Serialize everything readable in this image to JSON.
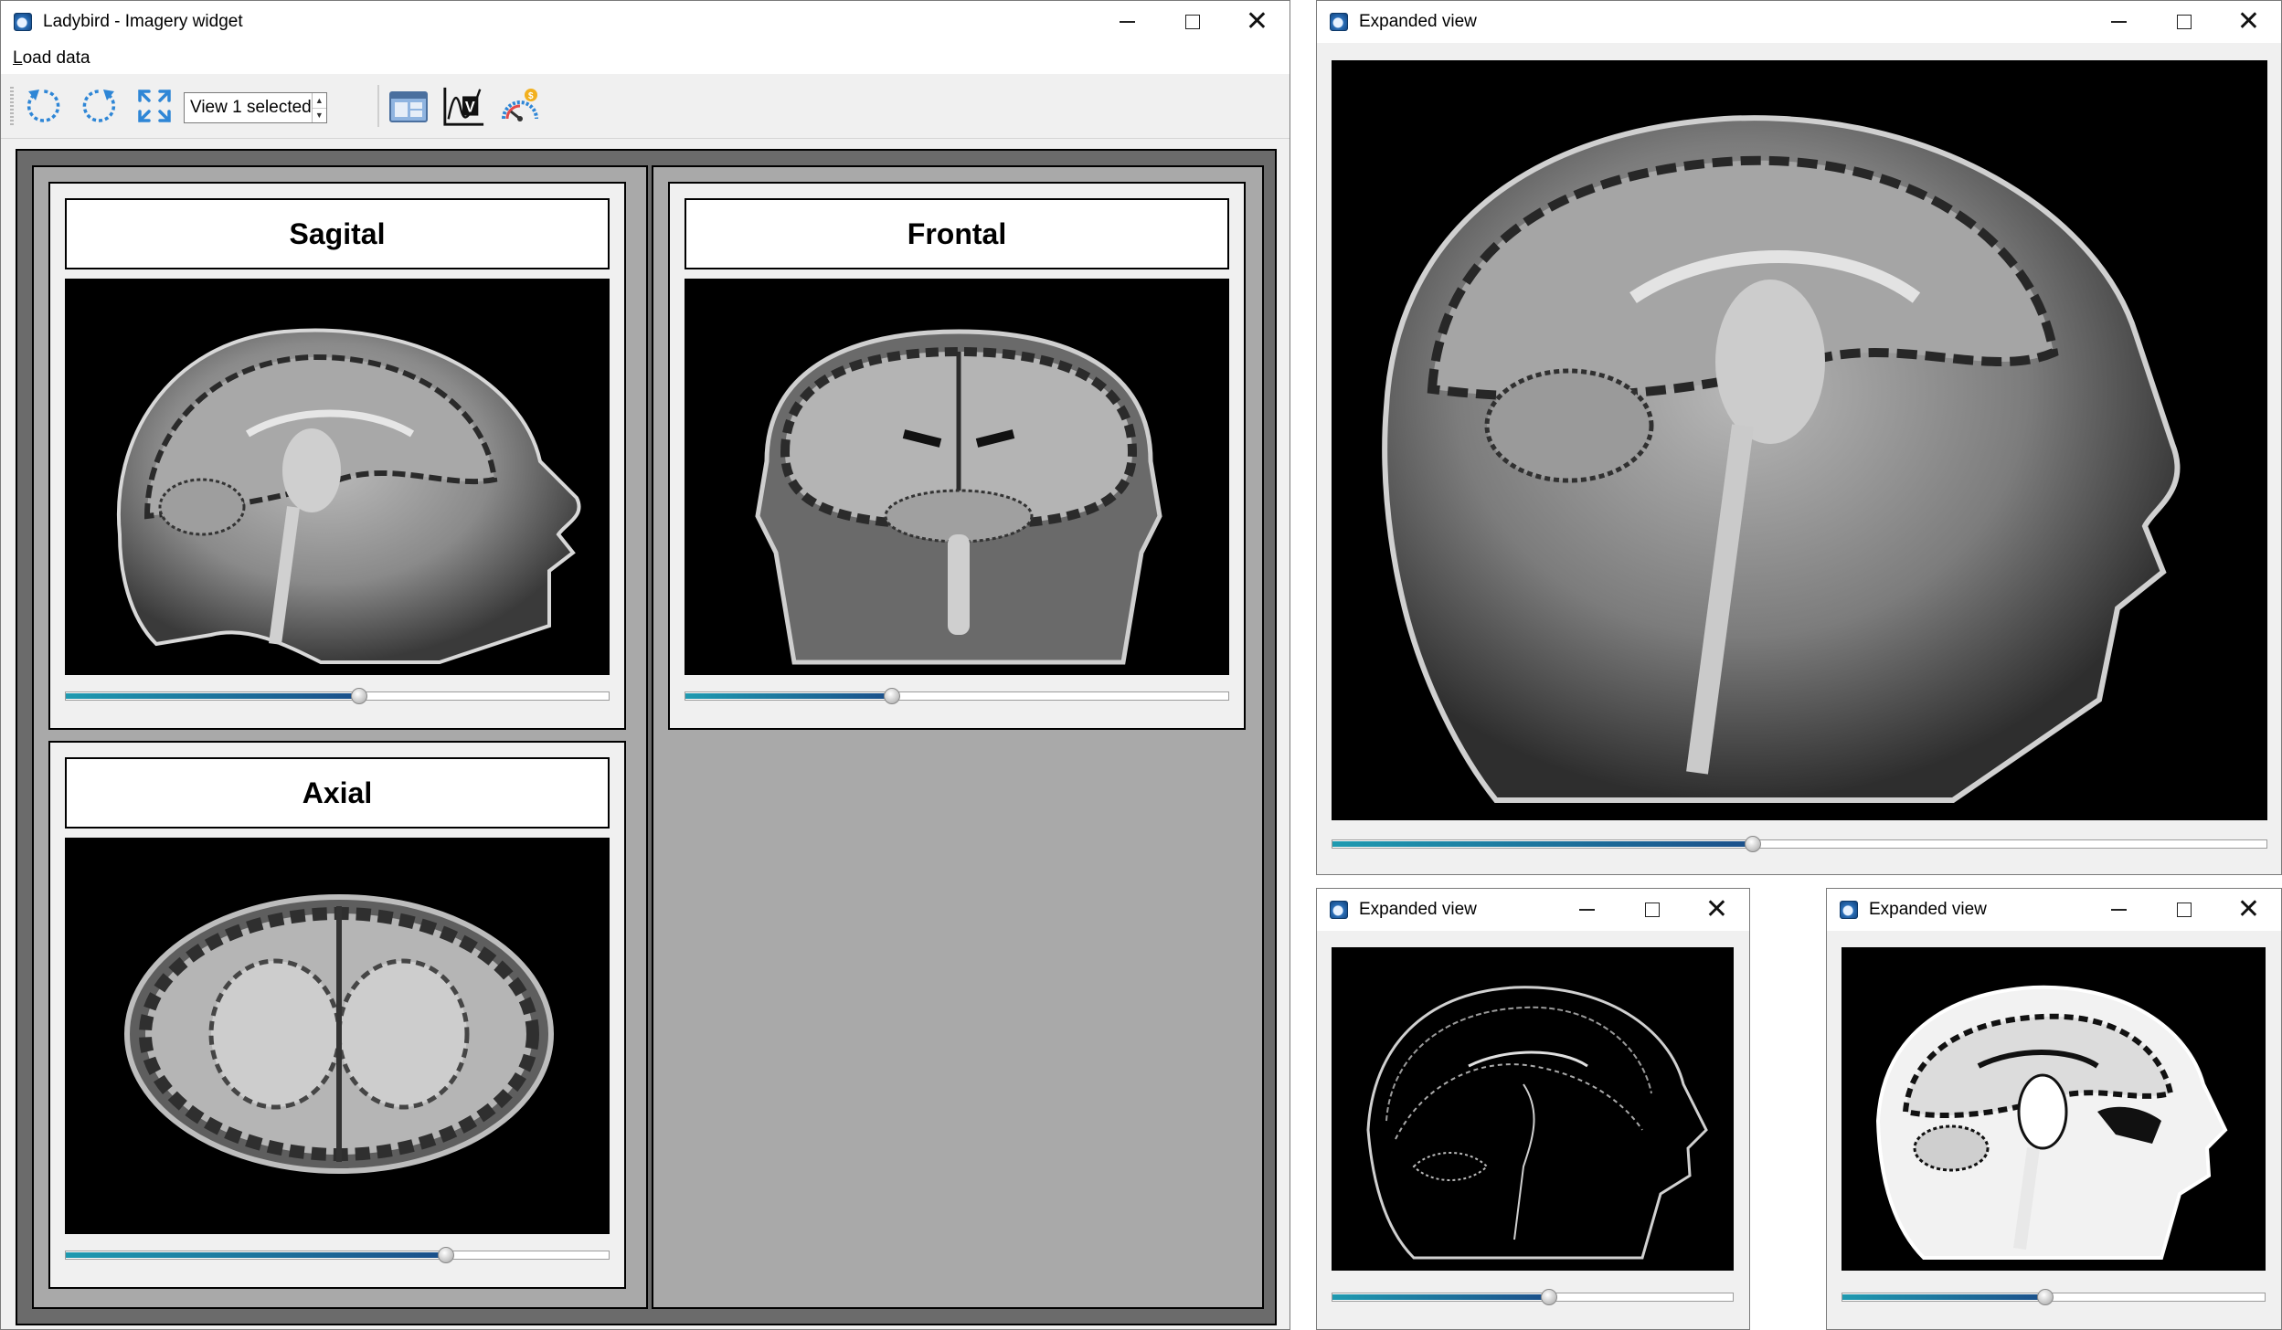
{
  "main_window": {
    "title": "Ladybird - Imagery widget",
    "menu": {
      "load_data_ul": "L",
      "load_data_rest": "oad data"
    },
    "toolbar": {
      "buttons": [
        "rotate-left-icon",
        "rotate-right-icon",
        "fit-screen-icon",
        "window-layout-icon",
        "chart-icon",
        "gauge-icon"
      ],
      "view_select_value": "View 1 selected"
    },
    "views": [
      {
        "label": "Sagital",
        "slider_fraction": 0.54
      },
      {
        "label": "Frontal",
        "slider_fraction": 0.38
      },
      {
        "label": "Axial",
        "slider_fraction": 0.7
      }
    ]
  },
  "expanded_windows": [
    {
      "title": "Expanded view",
      "image": "sagittal-mri-icon",
      "slider_fraction": 0.45
    },
    {
      "title": "Expanded view",
      "image": "sagittal-edge-mri-icon",
      "slider_fraction": 0.54
    },
    {
      "title": "Expanded view",
      "image": "sagittal-threshold-mri-icon",
      "slider_fraction": 0.48
    }
  ],
  "colors": {
    "slider_fill_start": "#1f9ab0",
    "slider_fill_end": "#1b4f8a",
    "canvas_bg": "#6b6b6b",
    "grid_bg": "#a9a9a9"
  }
}
